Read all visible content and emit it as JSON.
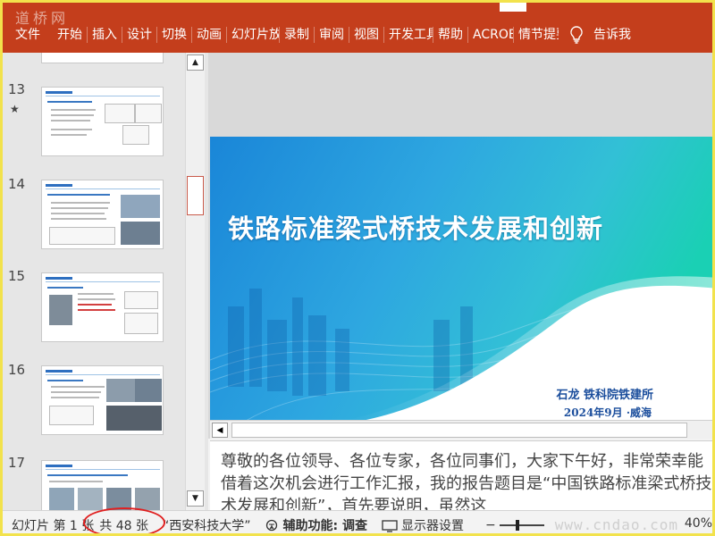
{
  "watermark_top": "道桥网",
  "ribbon": {
    "tabs": [
      "文件",
      "开始",
      "插入",
      "设计",
      "切换",
      "动画",
      "幻灯片放映",
      "录制",
      "审阅",
      "视图",
      "开发工具",
      "帮助",
      "ACROBAT",
      "情节提要",
      "告诉我"
    ]
  },
  "thumbnails": [
    {
      "number": "13",
      "star": "★"
    },
    {
      "number": "14"
    },
    {
      "number": "15"
    },
    {
      "number": "16"
    },
    {
      "number": "17"
    }
  ],
  "slide": {
    "title": "铁路标准梁式桥技术发展和创新",
    "author": "石龙 铁科院铁建所",
    "date": "2024年9月 ·威海"
  },
  "notes": {
    "text": "尊敬的各位领导、各位专家，各位同事们，大家下午好，非常荣幸能借着这次机会进行工作汇报，我的报告题目是“中国铁路标准梁式桥技术发展和创新”，首先要说明，虽然这"
  },
  "status_bar": {
    "slide_indicator": "幻灯片 第 1 张",
    "total": "共 48 张",
    "language": "“西安科技大学”",
    "accessibility_label": "辅助功能: 调查",
    "display_settings": "显示器设置",
    "zoom_minus": "−",
    "zoom_value": "40%"
  },
  "watermark_bottom": "www.cndao.com",
  "colors": {
    "ribbon": "#c43e1c",
    "highlight_circle": "#e02020",
    "slide_text": "#1a4d9c"
  }
}
